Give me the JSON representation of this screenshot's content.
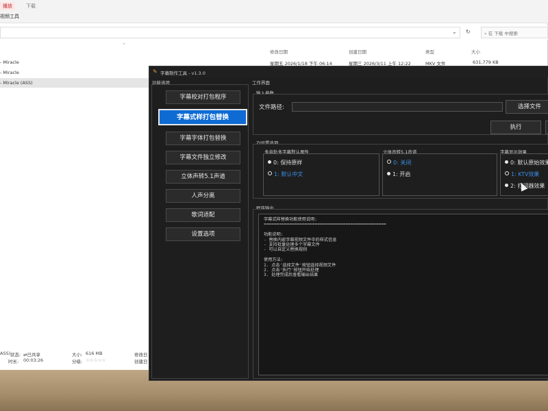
{
  "explorer": {
    "tabs": {
      "play": "播放",
      "download": "下载"
    },
    "tools_label": "视频工具",
    "search_placeholder": "在 下载 中搜索",
    "columns": {
      "date_modified": "修改日期",
      "date_created": "创建日期",
      "type": "类型",
      "size": "大小"
    },
    "files": [
      {
        "name": "- Miracle",
        "modified": "星期五 2026/1/18 下午 06:14",
        "created": "星期三 2026/3/11 上午 12:22",
        "type": "MKV 文件",
        "size": "631,779 KB"
      },
      {
        "name": "- Miracle",
        "modified": "",
        "created": "",
        "type": "",
        "size": ""
      },
      {
        "name": "- Miracle (ASS)",
        "modified": "",
        "created": "",
        "type": "",
        "size": ""
      }
    ],
    "status": {
      "name": "ASS)",
      "state_label": "状态:",
      "state_value": "已共享",
      "duration_label": "时长:",
      "duration_value": "00:03:26",
      "size_label": "大小:",
      "size_value": "616 MB",
      "rating_label": "分级:",
      "rating_value": "☆☆☆☆☆",
      "modified_label": "修改日",
      "created_label": "创建日"
    }
  },
  "app": {
    "title": "字幕制作工具 - v1.3.0",
    "left_panel_label": "功能选项",
    "right_panel_label": "工作界面",
    "menu": [
      "字幕校对打包程序",
      "字幕式样打包替换",
      "字幕字体打包替换",
      "字幕文件独立修改",
      "立体声转5.1声道",
      "人声分离",
      "歌词适配",
      "设置选项"
    ],
    "active_menu_index": 1,
    "input_group_label": "输入参数",
    "file_path_label": "文件路径:",
    "file_path_value": "",
    "select_file_button": "选择文件",
    "execute_button": "执行",
    "settings_group_label": "ZI设置选项",
    "options": [
      {
        "label": "多音轨多字幕默认属性",
        "items": [
          "0: 保持原样",
          "1: 默认中文"
        ],
        "selected": 1
      },
      {
        "label": "立体声转5.1声道",
        "items": [
          "0: 关闭",
          "1: 开启"
        ],
        "selected": 0
      },
      {
        "label": "字幕显示效果",
        "items": [
          "0: 默认原始效果",
          "1: KTV效果",
          "2: 打词器效果"
        ],
        "selected": 1
      }
    ],
    "output_label": "程序输出",
    "output_lines": [
      "字幕式样替换功能使用说明:",
      "================================================",
      "",
      "功能说明:",
      "- 替换内嵌字幕视频文件中的样式信息",
      "- 支持批量处理多个字幕文件",
      "- 可以自定义替换规则",
      "",
      "使用方法:",
      "1. 点击'选择文件'按钮选择视频文件",
      "2. 点击'执行'按钮开始处理",
      "3. 处理完成后查看输出结果"
    ]
  }
}
